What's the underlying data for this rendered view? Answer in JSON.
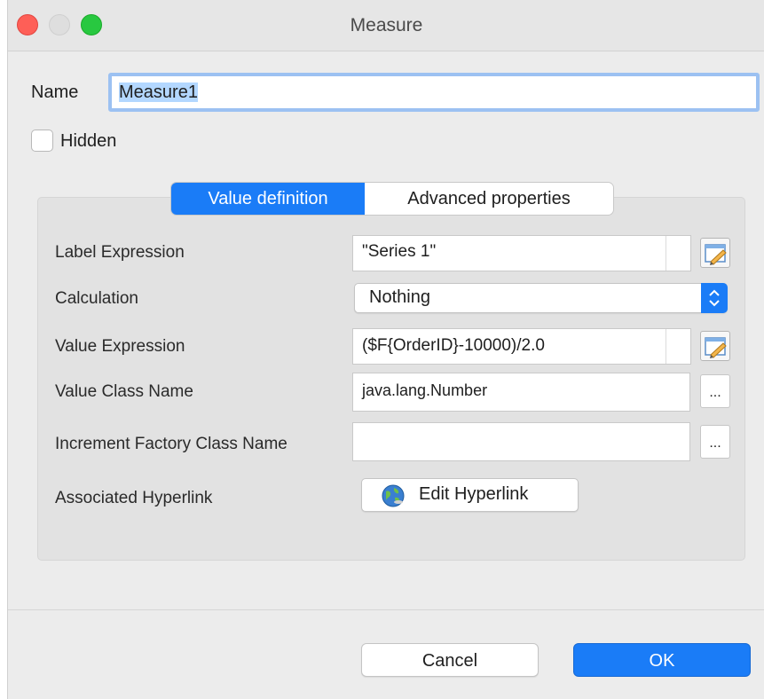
{
  "window": {
    "title": "Measure"
  },
  "name": {
    "label": "Name",
    "value": "Measure1"
  },
  "hidden": {
    "label": "Hidden",
    "checked": false
  },
  "tabs": [
    {
      "label": "Value definition",
      "active": true
    },
    {
      "label": "Advanced properties",
      "active": false
    }
  ],
  "fields": {
    "label_expression": {
      "label": "Label Expression",
      "value": "\"Series 1\""
    },
    "calculation": {
      "label": "Calculation",
      "value": "Nothing"
    },
    "value_expression": {
      "label": "Value Expression",
      "value": "($F{OrderID}-10000)/2.0"
    },
    "value_class_name": {
      "label": "Value Class Name",
      "value": "java.lang.Number",
      "button": "..."
    },
    "increment_factory": {
      "label": "Increment Factory Class Name",
      "value": "",
      "button": "..."
    },
    "hyperlink": {
      "label": "Associated Hyperlink",
      "button": "Edit Hyperlink"
    }
  },
  "footer": {
    "cancel": "Cancel",
    "ok": "OK"
  },
  "colors": {
    "accent": "#1a7cf7",
    "close": "#fe5f57",
    "maximize": "#28c840"
  },
  "icons": {
    "edit": "pencil-edit-icon",
    "hyperlink": "globe-icon",
    "stepper": "chevron-updown-icon"
  }
}
